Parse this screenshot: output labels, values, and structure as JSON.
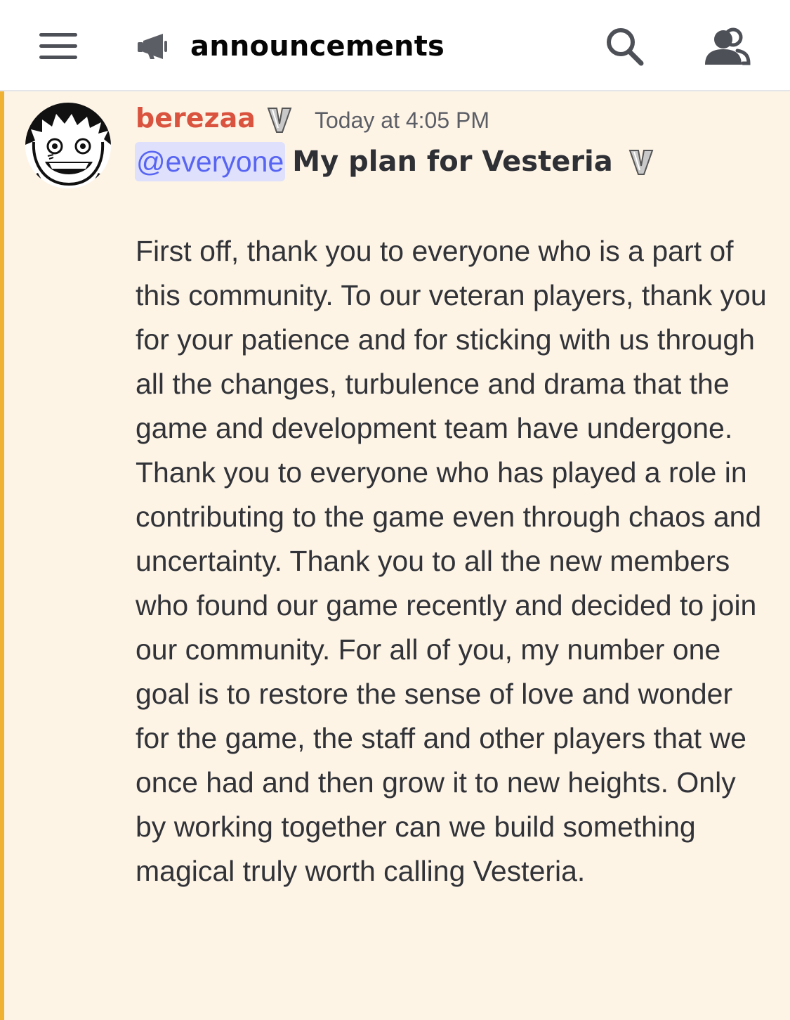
{
  "header": {
    "menu_icon": "hamburger-icon",
    "channel_icon": "megaphone-icon",
    "channel_name": "announcements",
    "search_icon": "search-icon",
    "members_icon": "members-icon"
  },
  "message": {
    "author": "berezaa",
    "author_color": "#d9533e",
    "timestamp": "Today at 4:05 PM",
    "mention": "@everyone",
    "title": "My plan for Vesteria",
    "body": "First off, thank you to everyone who is a part of this community. To our veteran players, thank you for your patience and for sticking with us through all the changes, turbulence and drama that the game and development team have undergone. Thank you to everyone who has played a role in contributing to the game even through chaos and uncertainty. Thank you to all the new members who found our game recently and decided to join our community. For all of you, my number one goal is to restore the sense of love and wonder for the game, the staff and other players that we once had and then grow it to new heights. Only by working together can we build something magical truly worth calling Vesteria.",
    "highlight_color": "#f0b232",
    "background_color": "#fdf4e6"
  }
}
